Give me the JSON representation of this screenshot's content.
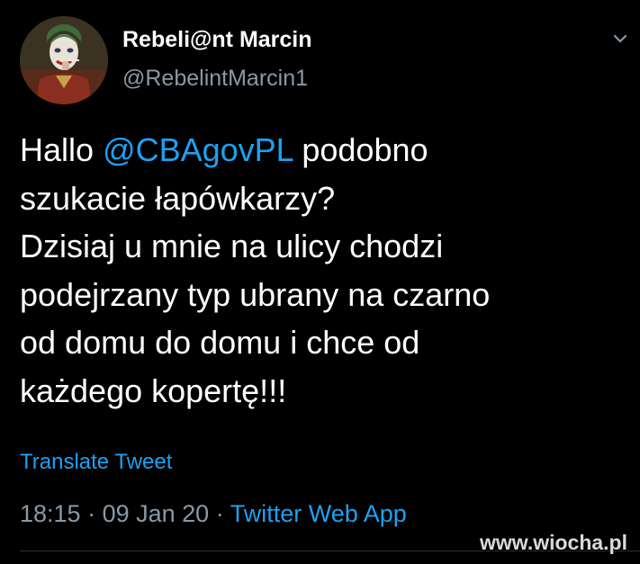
{
  "colors": {
    "background": "#000000",
    "text_primary": "#ffffff",
    "text_secondary": "#8899a6",
    "link": "#1da1f2",
    "divider": "#2f3336"
  },
  "author": {
    "avatar_icon": "joker-avatar",
    "display_name": "Rebeli@nt Marcin",
    "handle": "@RebelintMarcin1"
  },
  "tweet": {
    "lines": [
      {
        "before": "Hallo ",
        "mention": "@CBAgovPL",
        "after": " podobno"
      },
      {
        "text": "szukacie łapówkarzy?"
      },
      {
        "text": "Dzisiaj u mnie na ulicy chodzi"
      },
      {
        "text": "podejrzany typ ubrany na czarno"
      },
      {
        "text": "od domu do domu i chce od"
      },
      {
        "text": "każdego kopertę!!!"
      }
    ],
    "translate_label": "Translate Tweet"
  },
  "meta": {
    "time": "18:15",
    "separator": " · ",
    "date": "09 Jan 20",
    "source": "Twitter Web App"
  },
  "menu_icon": "chevron-down-icon",
  "watermark": "www.wiocha.pl"
}
